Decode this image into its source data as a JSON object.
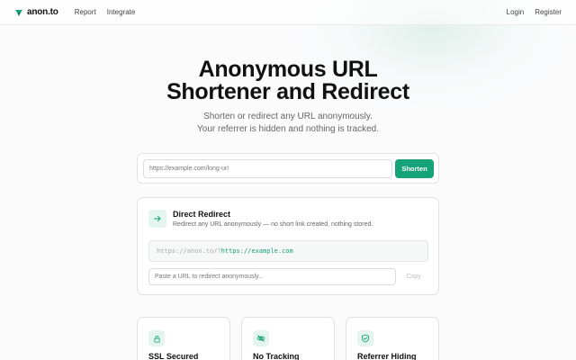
{
  "brand": {
    "name": "anon.to",
    "accent": "#16a37a"
  },
  "nav": {
    "links": [
      "Report",
      "Integrate"
    ],
    "right": [
      "Login",
      "Register"
    ]
  },
  "hero": {
    "title_line1": "Anonymous URL",
    "title_line2": "Shortener and Redirect",
    "subtitle_line1": "Shorten or redirect any URL anonymously.",
    "subtitle_line2": "Your referrer is hidden and nothing is tracked."
  },
  "shorten": {
    "placeholder": "https://example.com/long-url",
    "button_label": "Shorten"
  },
  "redirect": {
    "icon": "arrow-right-icon",
    "title": "Direct Redirect",
    "description": "Redirect any URL anonymously — no short link created, nothing stored.",
    "code_prefix": "https://anon.to/?",
    "code_url": "https://example.com",
    "input_placeholder": "Paste a URL to redirect anonymously...",
    "copy_label": "Copy"
  },
  "features": [
    {
      "icon": "lock-icon",
      "title": "SSL Secured"
    },
    {
      "icon": "eye-off-icon",
      "title": "No Tracking"
    },
    {
      "icon": "shield-icon",
      "title": "Referrer Hiding"
    }
  ]
}
